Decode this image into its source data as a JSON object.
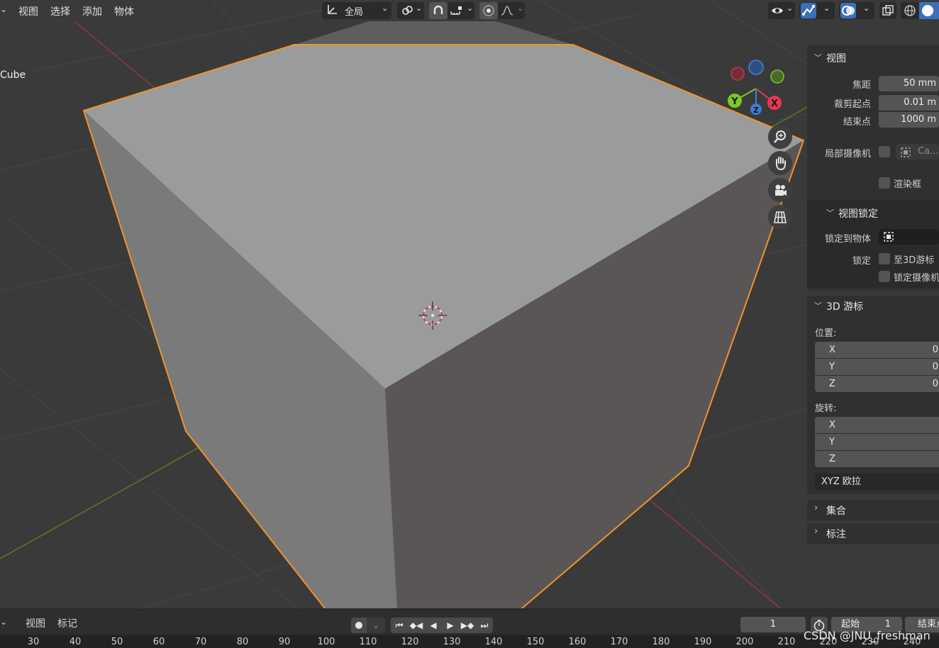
{
  "topbar": {
    "menu": [
      "视图",
      "选择",
      "添加",
      "物体"
    ],
    "transform_orientation": "全局"
  },
  "viewport": {
    "object_name": "Cube",
    "gizmo_labels": {
      "x": "X",
      "y": "Y",
      "z": "Z"
    }
  },
  "sidebar": {
    "view_section": {
      "title": "视图",
      "focal_label": "焦距",
      "focal_value": "50 mm",
      "clip_start_label": "裁剪起点",
      "clip_start_value": "0.01 m",
      "clip_end_label": "结束点",
      "clip_end_value": "1000 m",
      "local_camera_label": "局部摄像机",
      "local_camera_value": "Ca...",
      "render_border_label": "渲染框"
    },
    "view_lock": {
      "title": "视图锁定",
      "lock_to_object_label": "锁定到物体",
      "lock_label": "锁定",
      "lock_to_cursor_label": "至3D游标",
      "lock_camera_label": "锁定摄像机"
    },
    "cursor_section": {
      "title": "3D 游标",
      "location_label": "位置:",
      "location": [
        {
          "axis": "X",
          "value": "0"
        },
        {
          "axis": "Y",
          "value": "0"
        },
        {
          "axis": "Z",
          "value": "0"
        }
      ],
      "rotation_label": "旋转:",
      "rotation": [
        {
          "axis": "X"
        },
        {
          "axis": "Y"
        },
        {
          "axis": "Z"
        }
      ],
      "rotation_mode": "XYZ 欧拉"
    },
    "collections_title": "集合",
    "annotations_title": "标注"
  },
  "timeline": {
    "menu": [
      "视图",
      "标记"
    ],
    "current_frame": "1",
    "start_label": "起始",
    "start_value": "1",
    "end_label": "结束点",
    "ruler_ticks": [
      "30",
      "40",
      "50",
      "60",
      "70",
      "80",
      "90",
      "100",
      "110",
      "120",
      "130",
      "140",
      "150",
      "160",
      "170",
      "180",
      "190",
      "200",
      "210",
      "220",
      "230",
      "240"
    ]
  },
  "watermark": "CSDN @JNU_freshman",
  "colors": {
    "selection_outline": "#f0932b",
    "x_axis": "#e8384f",
    "y_axis": "#7ec823",
    "z_axis": "#3b7dd8"
  }
}
